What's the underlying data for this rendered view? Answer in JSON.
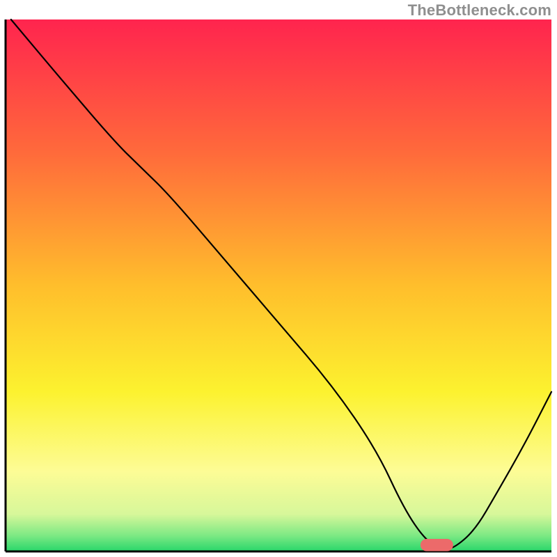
{
  "watermark": "TheBottleneck.com",
  "chart_data": {
    "type": "line",
    "title": "",
    "xlabel": "",
    "ylabel": "",
    "xlim": [
      0,
      100
    ],
    "ylim": [
      0,
      100
    ],
    "grid": false,
    "legend": false,
    "annotations": [],
    "background_gradient_stops": [
      {
        "offset": 0,
        "color": "#ff244e"
      },
      {
        "offset": 25,
        "color": "#ff6a3b"
      },
      {
        "offset": 50,
        "color": "#ffbe2c"
      },
      {
        "offset": 70,
        "color": "#fcf22f"
      },
      {
        "offset": 85,
        "color": "#fdfc96"
      },
      {
        "offset": 93,
        "color": "#d7f79a"
      },
      {
        "offset": 97,
        "color": "#7de984"
      },
      {
        "offset": 100,
        "color": "#28d66a"
      }
    ],
    "series": [
      {
        "name": "bottleneck-curve",
        "stroke": "#000000",
        "stroke_width": 2.2,
        "x": [
          1,
          10,
          20,
          25,
          30,
          40,
          50,
          60,
          68,
          73,
          77,
          80,
          82,
          86,
          90,
          95,
          100
        ],
        "y": [
          100,
          89,
          77,
          72,
          67,
          55,
          43,
          31,
          19,
          8,
          2,
          0.5,
          0.5,
          4,
          11,
          20,
          30
        ]
      }
    ],
    "markers": [
      {
        "name": "optimum-range-marker",
        "shape": "rounded-bar",
        "color": "#ec6a6a",
        "x_start": 76,
        "x_end": 82,
        "y": 1.2,
        "thickness": 2.3
      }
    ]
  }
}
